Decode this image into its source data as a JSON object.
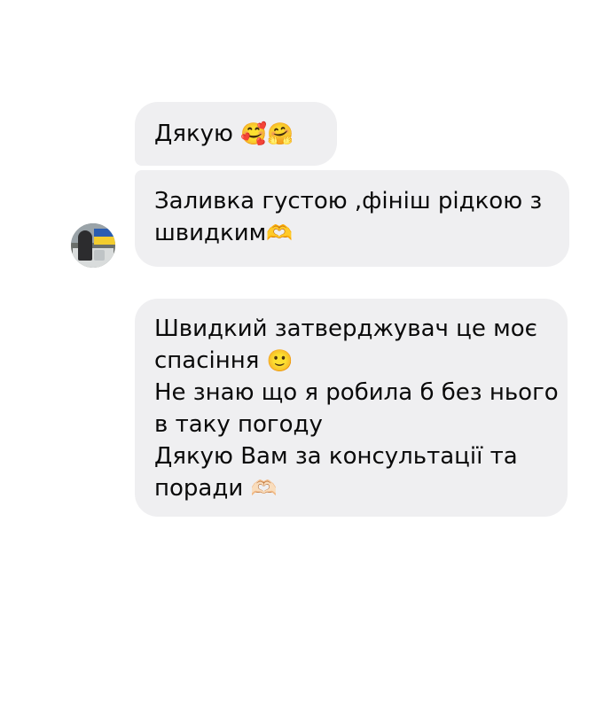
{
  "chat": {
    "messages": [
      {
        "lines": [
          {
            "text": "Дякую",
            "emoji": "🥰🤗"
          }
        ]
      },
      {
        "lines": [
          {
            "text": "Заливка густою ,фініш рідкою з",
            "emoji": ""
          },
          {
            "text": "швидким",
            "emoji": "🫶"
          }
        ]
      },
      {
        "lines": [
          {
            "text": "Швидкий затверджувач це моє",
            "emoji": ""
          },
          {
            "text": "спасіння ",
            "emoji": "🙂"
          },
          {
            "text": "Не знаю що я робила б без нього",
            "emoji": ""
          },
          {
            "text": "в таку погоду",
            "emoji": ""
          },
          {
            "text": "Дякую Вам за консультації та",
            "emoji": ""
          },
          {
            "text": "поради ",
            "emoji": "🫶🏻"
          }
        ]
      }
    ],
    "sender": {
      "avatar_icon": "profile-photo"
    }
  },
  "colors": {
    "bubble_background": "#efeff1",
    "text": "#0a0a0a",
    "page_background": "#ffffff"
  }
}
